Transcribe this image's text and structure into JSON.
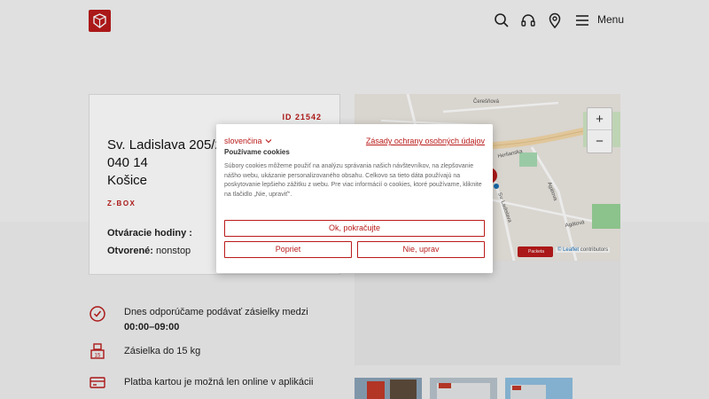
{
  "header": {
    "menu_label": "Menu",
    "icons": [
      "search-icon",
      "headset-icon",
      "location-pin-icon",
      "hamburger-icon"
    ]
  },
  "point": {
    "id": "ID 21542",
    "address_line1": "Sv. Ladislava 205/2",
    "address_line2": "040 14",
    "address_line3": "Košice",
    "type": "Z-BOX",
    "opening_hours_label": "Otváracie hodiny :",
    "open_label": "Otvorené:",
    "open_value": "nonstop"
  },
  "features": [
    {
      "icon": "clock-icon",
      "text_prefix": "Dnes odporúčame podávať zásielky medzi ",
      "text_bold": "00:00–09:00"
    },
    {
      "icon": "weight-15kg-icon",
      "text": "Zásielka do 15 kg"
    },
    {
      "icon": "card-payment-icon",
      "text": "Platba kartou je možná len online v aplikácii"
    }
  ],
  "map": {
    "street_labels": [
      "Čerešňová",
      "Herlianska",
      "Sv. Ladislava",
      "Agátova",
      "Agátová"
    ],
    "zoom_in": "+",
    "zoom_out": "−",
    "badge": "Packeta",
    "attribution_link": "© Leaflet",
    "attribution_text": "contributors"
  },
  "cookie": {
    "language": "slovenčina",
    "privacy_link": "Zásady ochrany osobných údajov",
    "title": "Používame cookies",
    "text": "Súbory cookies môžeme použiť na analýzu správania našich návštevníkov, na zlepšovanie nášho webu, ukázanie personalizovaného obsahu. Celkovo sa tieto dáta používajú na poskytovanie lepšieho zážitku z webu. Pre viac informácií o cookies, ktoré používame, kliknite na tlačidlo „Nie, upraviť\".",
    "accept": "Ok, pokračujte",
    "settings": "Popriet",
    "reject": "Nie, uprav"
  },
  "colors": {
    "brand_red": "#ba1b1b",
    "background": "#f4f4f4"
  }
}
